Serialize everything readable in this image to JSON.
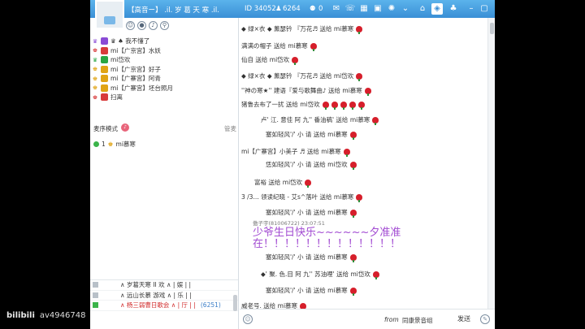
{
  "window": {
    "room_name": "【高音ー】 .il.  岁 葛 天 寒 .il.",
    "room_id": "ID 34052",
    "user_count": "6264",
    "online": "0"
  },
  "left_toolbar": {
    "icons": [
      "person-icon",
      "location-icon",
      "music-icon",
      "search-icon"
    ]
  },
  "users": [
    {
      "role_color": "#8a4bd6",
      "role_symbol": "♛",
      "name": "♛ ♠ 我不懂了"
    },
    {
      "role_color": "#d83b3b",
      "role_symbol": "♚",
      "name": "mi【广京宫】水妖"
    },
    {
      "role_color": "#29a642",
      "role_symbol": "♛",
      "name": "mi岱欢"
    },
    {
      "role_color": "#e0a414",
      "role_symbol": "♚",
      "name": "mi【广京宫】好子"
    },
    {
      "role_color": "#e0a414",
      "role_symbol": "♚",
      "name": "mi【广寨宫】阿青"
    },
    {
      "role_color": "#e0a414",
      "role_symbol": "♚",
      "name": "mi【广寨宫】坯台照月"
    },
    {
      "role_color": "#d83b3b",
      "role_symbol": "♚",
      "name": "扫离"
    }
  ],
  "mic": {
    "header_label": "麦序模式",
    "manage_label": "管麦",
    "entry_num": "1",
    "entry_name": "mi慕寒"
  },
  "chat": {
    "messages": [
      {
        "text": "◆ 绿×衣 ◆  薰瑟钤  『万花♬  送给  mi慕寒",
        "roses": 1
      },
      {
        "text": "满满の帽子  送给  mi慕寒",
        "roses": 1
      },
      {
        "text": "仙自  送给  mi岱欢",
        "roses": 1
      },
      {
        "text": "◆ 绿×衣 ◆  薰瑟钤  『万花♬  送给  mi岱欢",
        "roses": 1
      },
      {
        "text": "''神の寒★''     建语『爱与歌舞曲♪  送给  mi慕寒",
        "roses": 1
      },
      {
        "text": "猪鲁去布了一扰  送给  mi岱欢",
        "roses": 5
      },
      {
        "text": "卢' 江. 意佳  阿  九'' 番油稿'   送给  mi慕寒",
        "roses": 1
      },
      {
        "text": "塞如轻风'/' 小   请  送给  mi慕寒",
        "roses": 1
      },
      {
        "text": "mi【广寨宫】小美子  ♬ 送给  mi慕寒",
        "roses": 1
      },
      {
        "text": "恁如轻风'/' 小   请  送给  mi岱欢",
        "roses": 1
      },
      {
        "text": "富裕  送给  mi岱欢",
        "roses": 1
      },
      {
        "text": "3 /3... 领读纪晓 - 艾s^落叶  送给  mi慕寒",
        "roses": 1
      },
      {
        "text": "塞如轻风'/' 小   请  送给  mi慕寒",
        "roses": 1
      },
      {
        "text": "塞如轻风'/' 小   请  送给  mi慕寒",
        "roses": 1
      },
      {
        "text": "◆' 聚. 色.目  阿  九'' 苏油哩'  送给  mi岱欢",
        "roses": 1
      },
      {
        "text": "塞如轻风'/' 小   请  送给  mi慕寒",
        "roses": 1
      },
      {
        "text": "威老号.  送给  mi慕寒",
        "roses": 1
      }
    ],
    "sender_line": "傲子宇(81006722)  23:07:51",
    "birthday_text": "少爷生日快乐~~~~~~夕准准在！！！！！！！！！！！！！"
  },
  "bottom_list": [
    {
      "text": "∧ 岁葛天寒 II 欢 ∧ | 娱  |   |",
      "num": ""
    },
    {
      "text": "∧ 远山长慕  游戏  ∧ | 乐  |   |",
      "num": ""
    },
    {
      "text": "∧ 杨三弱曹日歌会  ∧ | 厅  |   |",
      "num": "(6251)"
    }
  ],
  "input": {
    "from_label": "from",
    "to_label": "同康景音组",
    "send_label": "发送"
  },
  "watermark": {
    "logo": "bilibili",
    "av": "av4946748"
  },
  "colors": {
    "titlebar": "#3a8fd6",
    "rose": "#d61f2b",
    "birthday": "#a24bd2"
  }
}
